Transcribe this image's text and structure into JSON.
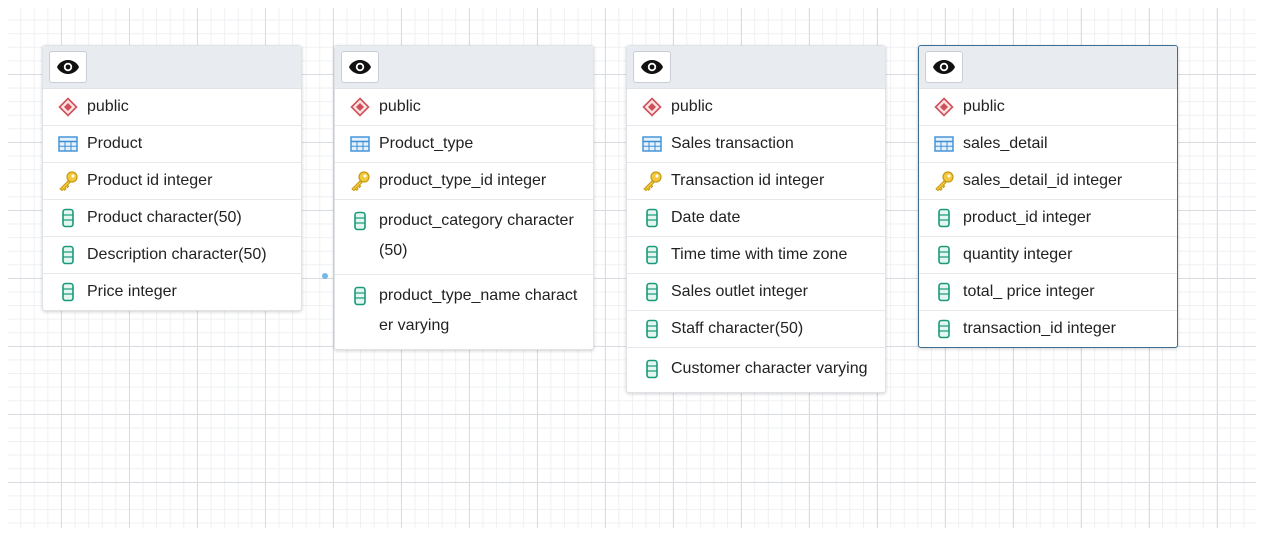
{
  "tables": [
    {
      "schema": "public",
      "name": "Product",
      "selected": false,
      "columns": [
        {
          "text": "Product id integer",
          "kind": "key"
        },
        {
          "text": "Product character(50)",
          "kind": "column"
        },
        {
          "text": "Description character(50)",
          "kind": "column"
        },
        {
          "text": "Price integer",
          "kind": "column"
        }
      ]
    },
    {
      "schema": "public",
      "name": "Product_type",
      "selected": false,
      "columns": [
        {
          "text": "product_type_id integer",
          "kind": "key"
        },
        {
          "text": "product_category character(50)",
          "kind": "column"
        },
        {
          "text": "product_type_name character varying",
          "kind": "column"
        }
      ]
    },
    {
      "schema": "public",
      "name": "Sales transaction",
      "selected": false,
      "columns": [
        {
          "text": "Transaction id integer",
          "kind": "key"
        },
        {
          "text": "Date date",
          "kind": "column"
        },
        {
          "text": "Time time with time zone",
          "kind": "column"
        },
        {
          "text": "Sales outlet integer",
          "kind": "column"
        },
        {
          "text": "Staff character(50)",
          "kind": "column"
        },
        {
          "text": "Customer character varying",
          "kind": "column"
        }
      ]
    },
    {
      "schema": "public",
      "name": "sales_detail",
      "selected": true,
      "columns": [
        {
          "text": "sales_detail_id integer",
          "kind": "key"
        },
        {
          "text": "product_id integer",
          "kind": "column"
        },
        {
          "text": "quantity integer",
          "kind": "column"
        },
        {
          "text": "total_ price integer",
          "kind": "column"
        },
        {
          "text": "transaction_id integer",
          "kind": "column"
        }
      ]
    }
  ],
  "icons": {
    "toggle": "eye-icon",
    "schema": "schema-diamond-icon",
    "table": "table-grid-icon",
    "key": "primary-key-icon",
    "column": "column-cylinder-icon"
  },
  "colors": {
    "schema_icon": "#d0505a",
    "table_icon": "#3b8fd6",
    "key_icon": "#e2b524",
    "column_icon": "#1a9a7a",
    "selected_border": "#3c6e91",
    "header_bg": "#e8ebf0"
  }
}
